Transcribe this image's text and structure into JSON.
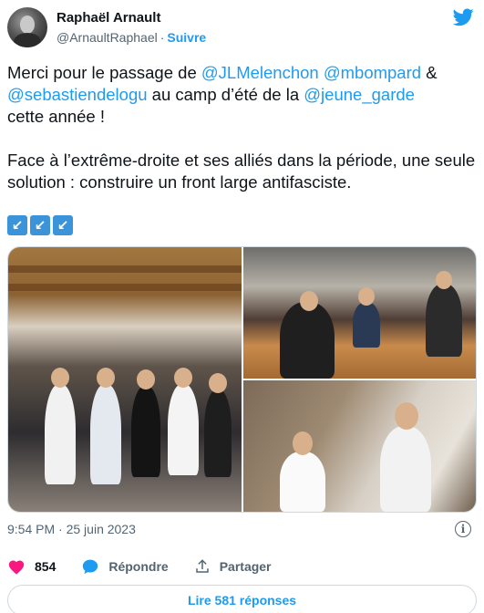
{
  "author": {
    "name": "Raphaël Arnault",
    "handle": "@ArnaultRaphael",
    "separator": "·",
    "follow_label": "Suivre"
  },
  "icons": {
    "logo": "twitter-bird-icon",
    "info": "info-icon",
    "like": "heart-icon",
    "reply": "speech-bubble-icon",
    "share": "share-arrow-icon"
  },
  "tweet": {
    "line1_prefix": "Merci pour le passage de ",
    "mention_1": "@JLMelenchon",
    "mention_2": "@mbompard",
    "amp": " &",
    "mention_3": "@sebastiendelogu",
    "line2_mid": " au camp d’été de la ",
    "mention_4": "@jeune_garde",
    "line3": "cette année !",
    "paragraph2": "Face à l’extrême-droite et ses alliés dans la période, une seule solution : construire un front large antifasciste.",
    "emojis": [
      "↙",
      "↙",
      "↙"
    ]
  },
  "meta": {
    "time": "9:54 PM",
    "separator": "·",
    "date": "25 juin 2023",
    "info_glyph": "i"
  },
  "actions": {
    "like_count": "854",
    "reply_label": "Répondre",
    "share_label": "Partager"
  },
  "replies_button": "Lire 581 réponses",
  "colors": {
    "accent": "#1d9bf0",
    "like": "#f91880",
    "text": "#0f1419",
    "muted": "#536471"
  }
}
